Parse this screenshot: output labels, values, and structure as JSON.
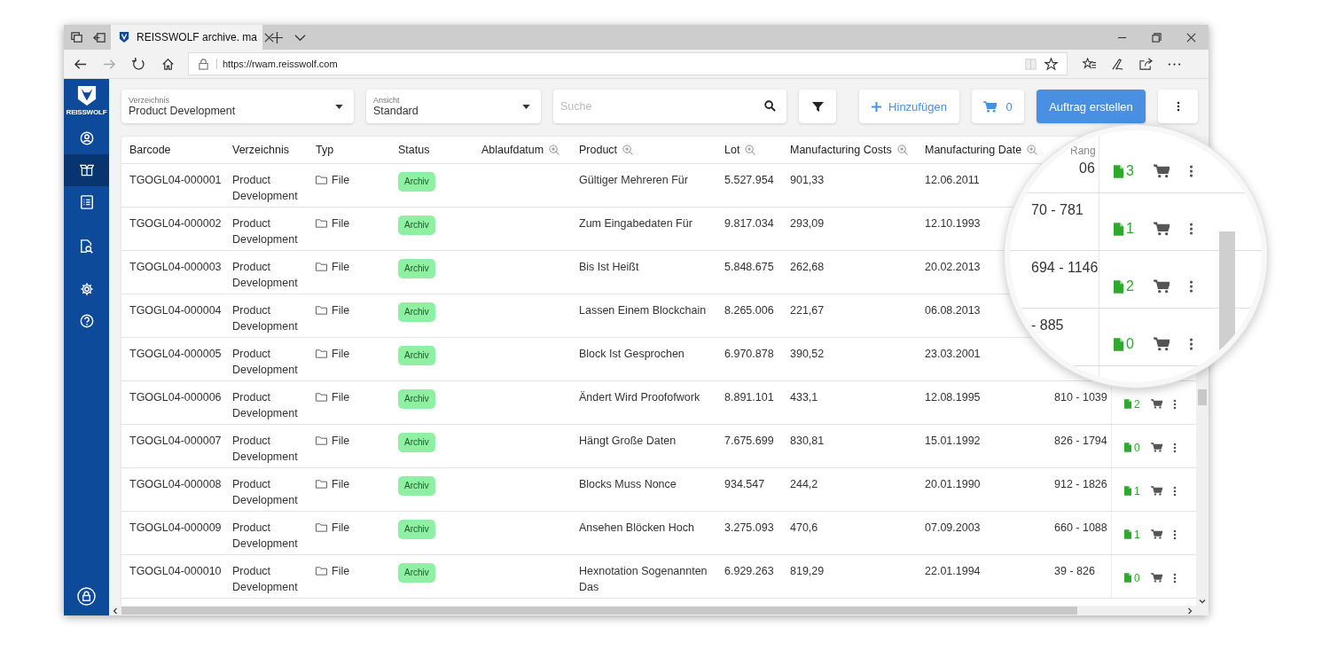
{
  "browser": {
    "tab_title": "REISSWOLF archive. ma",
    "url": "https://rwam.reisswolf.com"
  },
  "sidebar": {
    "logo_text": "REISSWOLF",
    "items": [
      {
        "kind": "user",
        "selected": false
      },
      {
        "kind": "box",
        "selected": true
      },
      {
        "kind": "list",
        "selected": false
      },
      {
        "kind": "doc-search",
        "selected": false
      },
      {
        "kind": "settings",
        "selected": false
      },
      {
        "kind": "help",
        "selected": false
      },
      {
        "kind": "lock",
        "selected": false
      }
    ]
  },
  "toolbar": {
    "directory": {
      "label": "Verzeichnis",
      "value": "Product Development"
    },
    "view": {
      "label": "Ansicht",
      "value": "Standard"
    },
    "search": {
      "placeholder": "Suche"
    },
    "add_button": "Hinzufügen",
    "cart_count": "0",
    "create_button": "Auftrag erstellen"
  },
  "table": {
    "columns": [
      {
        "label": "Barcode",
        "filterable": false
      },
      {
        "label": "Verzeichnis",
        "filterable": false
      },
      {
        "label": "Typ",
        "filterable": false
      },
      {
        "label": "Status",
        "filterable": false
      },
      {
        "label": "Ablaufdatum",
        "filterable": true
      },
      {
        "label": "Product",
        "filterable": true
      },
      {
        "label": "Lot",
        "filterable": true
      },
      {
        "label": "Manufacturing Costs",
        "filterable": true
      },
      {
        "label": "Manufacturing Date",
        "filterable": true
      }
    ],
    "rows": [
      {
        "barcode": "TGOGL04-000001",
        "directory": "Product Development",
        "type": "File",
        "status": "Archiv",
        "product": "Gültiger Mehreren Für",
        "lot": "5.527.954",
        "costs": "901,33",
        "date": "12.06.2011"
      },
      {
        "barcode": "TGOGL04-000002",
        "directory": "Product Development",
        "type": "File",
        "status": "Archiv",
        "product": "Zum Eingabedaten Für",
        "lot": "9.817.034",
        "costs": "293,09",
        "date": "12.10.1993"
      },
      {
        "barcode": "TGOGL04-000003",
        "directory": "Product Development",
        "type": "File",
        "status": "Archiv",
        "product": "Bis Ist Heißt",
        "lot": "5.848.675",
        "costs": "262,68",
        "date": "20.02.2013"
      },
      {
        "barcode": "TGOGL04-000004",
        "directory": "Product Development",
        "type": "File",
        "status": "Archiv",
        "product": "Lassen Einem Blockchain",
        "lot": "8.265.006",
        "costs": "221,67",
        "date": "06.08.2013"
      },
      {
        "barcode": "TGOGL04-000005",
        "directory": "Product Development",
        "type": "File",
        "status": "Archiv",
        "product": "Block Ist Gesprochen",
        "lot": "6.970.878",
        "costs": "390,52",
        "date": "23.03.2001"
      },
      {
        "barcode": "TGOGL04-000006",
        "directory": "Product Development",
        "type": "File",
        "status": "Archiv",
        "product": "Ändert Wird Proofofwork",
        "lot": "8.891.101",
        "costs": "433,1",
        "date": "12.08.1995",
        "range": "810 - 1039",
        "docs": "2"
      },
      {
        "barcode": "TGOGL04-000007",
        "directory": "Product Development",
        "type": "File",
        "status": "Archiv",
        "product": "Hängt Große Daten",
        "lot": "7.675.699",
        "costs": "830,81",
        "date": "15.01.1992",
        "range": "826 - 1794",
        "docs": "0"
      },
      {
        "barcode": "TGOGL04-000008",
        "directory": "Product Development",
        "type": "File",
        "status": "Archiv",
        "product": "Blocks Muss Nonce",
        "lot": "934.547",
        "costs": "244,2",
        "date": "20.01.1990",
        "range": "912 - 1826",
        "docs": "1"
      },
      {
        "barcode": "TGOGL04-000009",
        "directory": "Product Development",
        "type": "File",
        "status": "Archiv",
        "product": "Ansehen Blöcken Hoch",
        "lot": "3.275.093",
        "costs": "470,6",
        "date": "07.09.2003",
        "range": "660 - 1088",
        "docs": "1"
      },
      {
        "barcode": "TGOGL04-000010",
        "directory": "Product Development",
        "type": "File",
        "status": "Archiv",
        "product": "Hexnotation Sogenannten Das",
        "lot": "6.929.263",
        "costs": "819,29",
        "date": "22.01.1994",
        "range": "39 - 826",
        "docs": "0"
      }
    ]
  },
  "magnifier": {
    "header": "Rang",
    "rows": [
      {
        "range": "06",
        "docs": "3"
      },
      {
        "range": "70 - 781",
        "docs": "1"
      },
      {
        "range": "694 - 1146",
        "docs": "2"
      },
      {
        "range": "- 885",
        "docs": "0"
      }
    ]
  }
}
